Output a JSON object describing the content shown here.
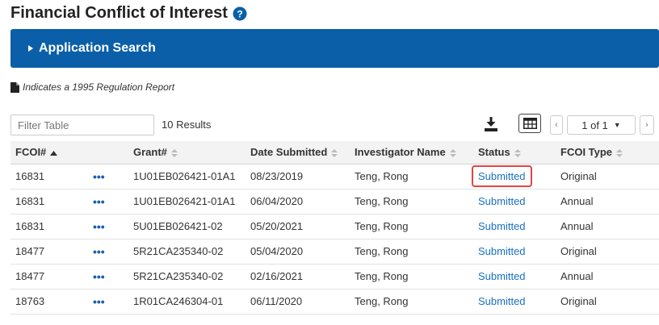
{
  "page": {
    "title": "Financial Conflict of Interest",
    "help_icon": "question-circle-icon"
  },
  "search_panel": {
    "label": "Application Search",
    "icon": "caret-right-icon",
    "color": "#0a5fa8"
  },
  "legend": {
    "icon": "document-icon",
    "text": "Indicates a 1995 Regulation Report"
  },
  "toolbar": {
    "filter_placeholder": "Filter Table",
    "results_text": "10 Results",
    "download_icon": "download-icon",
    "columns_icon": "table-columns-icon",
    "pager": {
      "prev_icon": "chevron-left-icon",
      "page_text": "1 of 1",
      "next_icon": "chevron-right-icon"
    }
  },
  "table": {
    "columns": [
      "FCOI#",
      "",
      "Grant#",
      "Date Submitted",
      "Investigator Name",
      "Status",
      "FCOI Type"
    ],
    "rows": [
      {
        "fcoi": "16831",
        "grant": "1U01EB026421-01A1",
        "date": "08/23/2019",
        "investigator": "Teng, Rong",
        "status": "Submitted",
        "type": "Original",
        "highlight": true
      },
      {
        "fcoi": "16831",
        "grant": "1U01EB026421-01A1",
        "date": "06/04/2020",
        "investigator": "Teng, Rong",
        "status": "Submitted",
        "type": "Annual"
      },
      {
        "fcoi": "16831",
        "grant": "5U01EB026421-02",
        "date": "05/20/2021",
        "investigator": "Teng, Rong",
        "status": "Submitted",
        "type": "Annual"
      },
      {
        "fcoi": "18477",
        "grant": "5R21CA235340-02",
        "date": "05/04/2020",
        "investigator": "Teng, Rong",
        "status": "Submitted",
        "type": "Original"
      },
      {
        "fcoi": "18477",
        "grant": "5R21CA235340-02",
        "date": "02/16/2021",
        "investigator": "Teng, Rong",
        "status": "Submitted",
        "type": "Annual"
      },
      {
        "fcoi": "18763",
        "grant": "1R01CA246304-01",
        "date": "06/11/2020",
        "investigator": "Teng, Rong",
        "status": "Submitted",
        "type": "Original"
      }
    ],
    "action_label": "•••",
    "highlight_color": "#e04545"
  }
}
